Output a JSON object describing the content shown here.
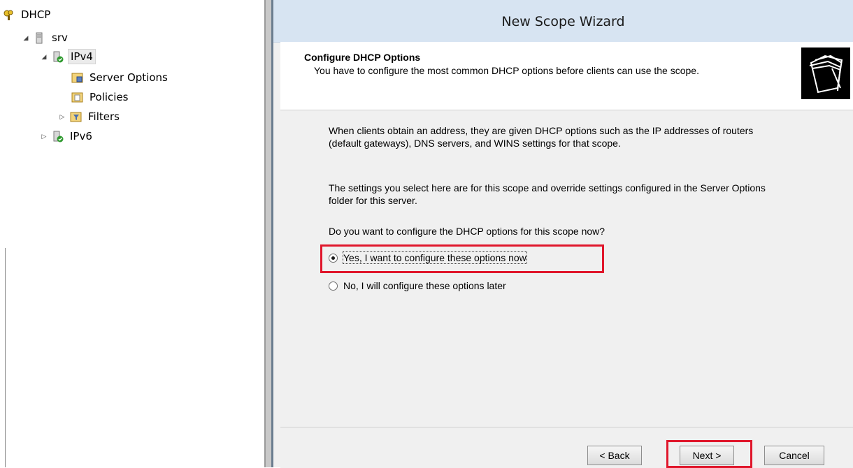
{
  "tree": {
    "root": {
      "label": "DHCP",
      "icon": "dhcp-icon"
    },
    "server": {
      "label": "srv",
      "icon": "server-icon"
    },
    "ipv4": {
      "label": "IPv4",
      "icon": "ipv4-server-icon"
    },
    "server_options": {
      "label": "Server Options",
      "icon": "options-icon"
    },
    "policies": {
      "label": "Policies",
      "icon": "policies-icon"
    },
    "filters": {
      "label": "Filters",
      "icon": "filters-icon"
    },
    "ipv6": {
      "label": "IPv6",
      "icon": "ipv6-server-icon"
    }
  },
  "wizard": {
    "title": "New Scope Wizard",
    "header_title": "Configure DHCP Options",
    "header_subtitle": "You have to configure the most common DHCP options before clients can use the scope.",
    "para1": "When clients obtain an address, they are given DHCP options such as the IP addresses of routers (default gateways), DNS servers, and WINS settings for that scope.",
    "para2": "The settings you select here are for this scope and override settings configured in the Server Options folder for this server.",
    "question": "Do you want to configure the DHCP options for this scope now?",
    "option_yes": "Yes, I want to configure these options now",
    "option_no": "No, I will configure these options later",
    "selected_option": "option_yes",
    "back_label": "< Back",
    "next_label": "Next >",
    "cancel_label": "Cancel"
  },
  "colors": {
    "highlight": "#e0162b",
    "titlebar": "#d7e4f2",
    "dialog_bg": "#f0f0f0"
  }
}
